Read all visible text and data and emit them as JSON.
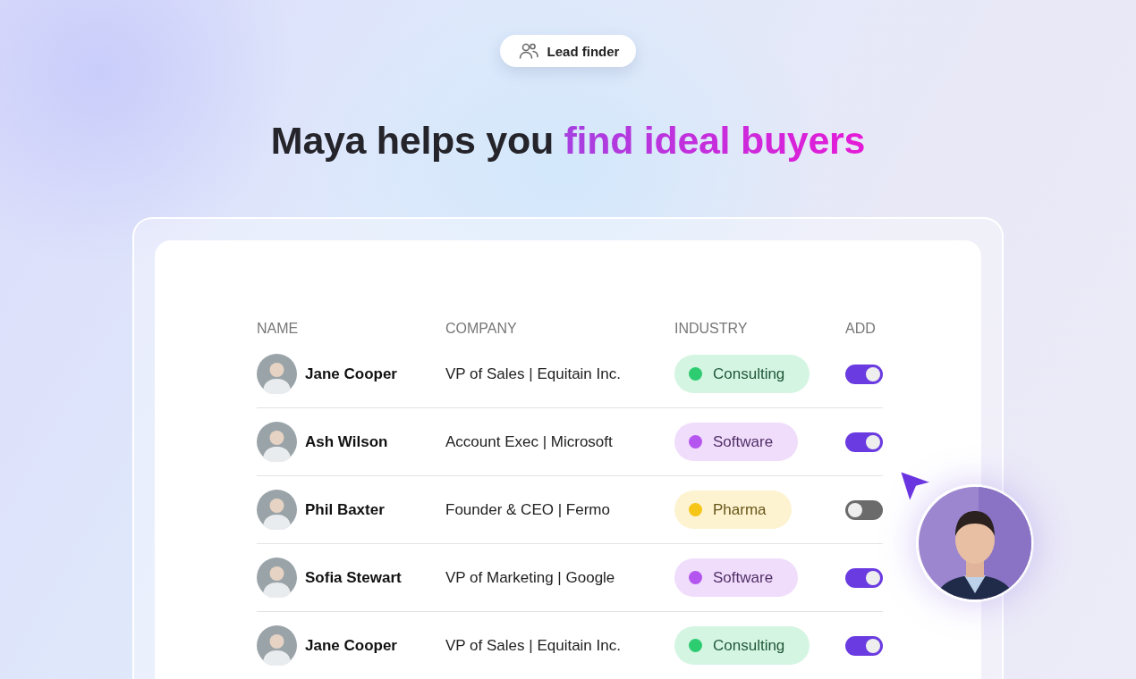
{
  "badge": {
    "label": "Lead finder"
  },
  "heading": {
    "text": "Maya helps you ",
    "highlight": "find ideal buyers"
  },
  "table": {
    "columns": [
      "NAME",
      "COMPANY",
      "INDUSTRY",
      "ADD"
    ],
    "rows": [
      {
        "name": "Jane Cooper",
        "company": "VP of Sales | Equitain Inc.",
        "industry": "Consulting",
        "color": "#2ecc71",
        "added": true
      },
      {
        "name": "Ash Wilson",
        "company": "Account Exec | Microsoft",
        "industry": "Software",
        "color": "#b455f0",
        "added": true
      },
      {
        "name": "Phil Baxter",
        "company": "Founder & CEO | Fermo",
        "industry": "Pharma",
        "color": "#f5c518",
        "added": false
      },
      {
        "name": "Sofia Stewart",
        "company": "VP of Marketing | Google",
        "industry": "Software",
        "color": "#b455f0",
        "added": true
      },
      {
        "name": "Jane Cooper",
        "company": "VP of Sales | Equitain Inc.",
        "industry": "Consulting",
        "color": "#2ecc71",
        "added": true
      }
    ]
  }
}
